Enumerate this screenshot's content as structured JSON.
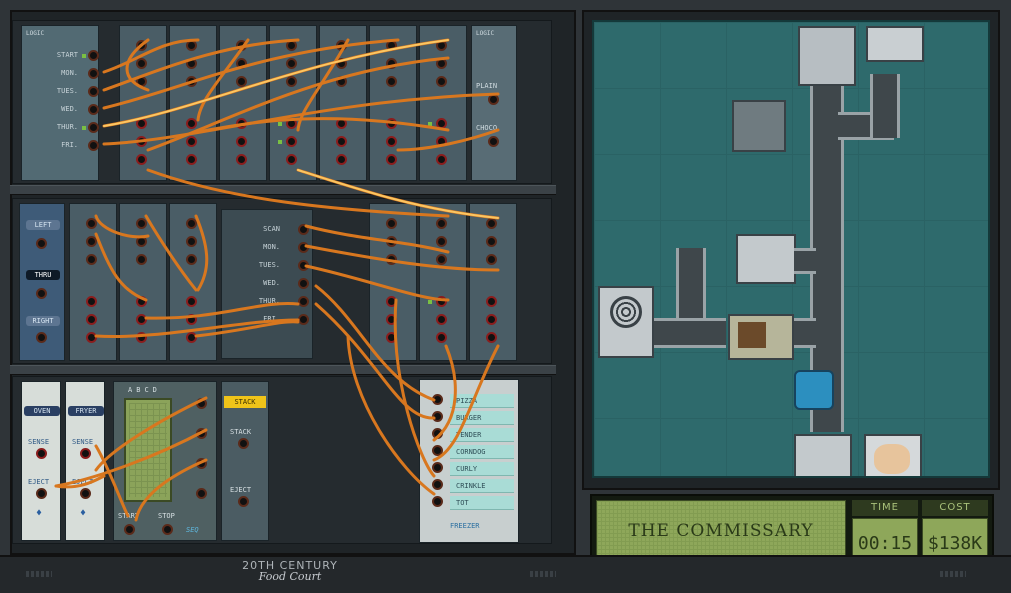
{
  "panel_brand": {
    "line1": "20TH CENTURY",
    "line2": "Food Court"
  },
  "rack1": {
    "scheduler_tag": "LOGIC",
    "day_labels": [
      "START",
      "MON.",
      "TUES.",
      "WED.",
      "THUR.",
      "FRI."
    ],
    "splitter_tag": "LOGIC",
    "flavor_labels": [
      "PLAIN",
      "CHOCO"
    ]
  },
  "rack2": {
    "router_labels": [
      "LEFT",
      "THRU",
      "RIGHT"
    ],
    "scanner_labels": [
      "SCAN",
      "MON.",
      "TUES.",
      "WED.",
      "THUR.",
      "FRI."
    ]
  },
  "rack3": {
    "oven": {
      "title": "OVEN",
      "sense": "SENSE",
      "eject": "EJECT"
    },
    "fryer": {
      "title": "FRYER",
      "sense": "SENSE",
      "eject": "EJECT"
    },
    "seq": {
      "columns": [
        "A",
        "B",
        "C",
        "D"
      ],
      "start": "START",
      "stop": "STOP",
      "tag": "SEQ"
    },
    "stack": {
      "title": "STACK",
      "stack": "STACK",
      "eject": "EJECT"
    },
    "freezer": {
      "items": [
        "PIZZA",
        "BURGER",
        "TENDER",
        "CORNDOG",
        "CURLY",
        "CRINKLE",
        "TOT"
      ],
      "title": "FREEZER"
    }
  },
  "hud": {
    "level_name": "THE COMMISSARY",
    "time_label": "TIME",
    "time_value": "00:15",
    "cost_label": "COST",
    "cost_value": "$138K"
  },
  "colors": {
    "wire": "#d8771f",
    "floor": "#2e6a6c",
    "lcd": "#8ea75a",
    "accent": "#f0c419"
  }
}
